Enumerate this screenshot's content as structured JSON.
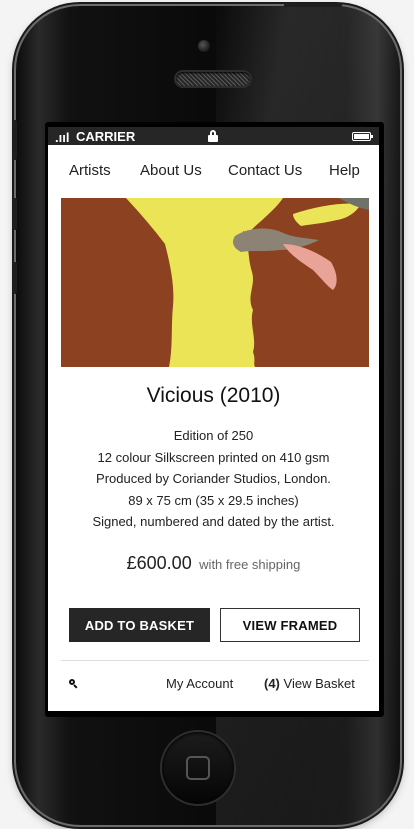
{
  "status_bar": {
    "signal_glyph": ".ııl",
    "carrier": "CARRIER"
  },
  "nav": {
    "items": [
      {
        "label": "Artists"
      },
      {
        "label": "About Us"
      },
      {
        "label": "Contact Us"
      },
      {
        "label": "Help"
      }
    ]
  },
  "product": {
    "title": "Vicious (2010)",
    "details": [
      "Edition of 250",
      "12 colour Silkscreen printed on 410 gsm",
      "Produced by Coriander Studios, London.",
      "89 x 75 cm (35 x 29.5 inches)",
      "Signed, numbered and dated by the artist."
    ],
    "price": "£600.00",
    "shipping_note": "with free shipping"
  },
  "actions": {
    "add_to_basket": "ADD TO BASKET",
    "view_framed": "VIEW FRAMED"
  },
  "footer": {
    "search_icon": "search-icon",
    "my_account": "My Account",
    "basket_count": "(4)",
    "view_basket": "View Basket"
  },
  "colors": {
    "artwork_brown": "#8c4220",
    "artwork_yellow": "#ece457",
    "artwork_pink": "#e9a397",
    "artwork_grey": "#8d8374",
    "button_dark": "#262626"
  }
}
